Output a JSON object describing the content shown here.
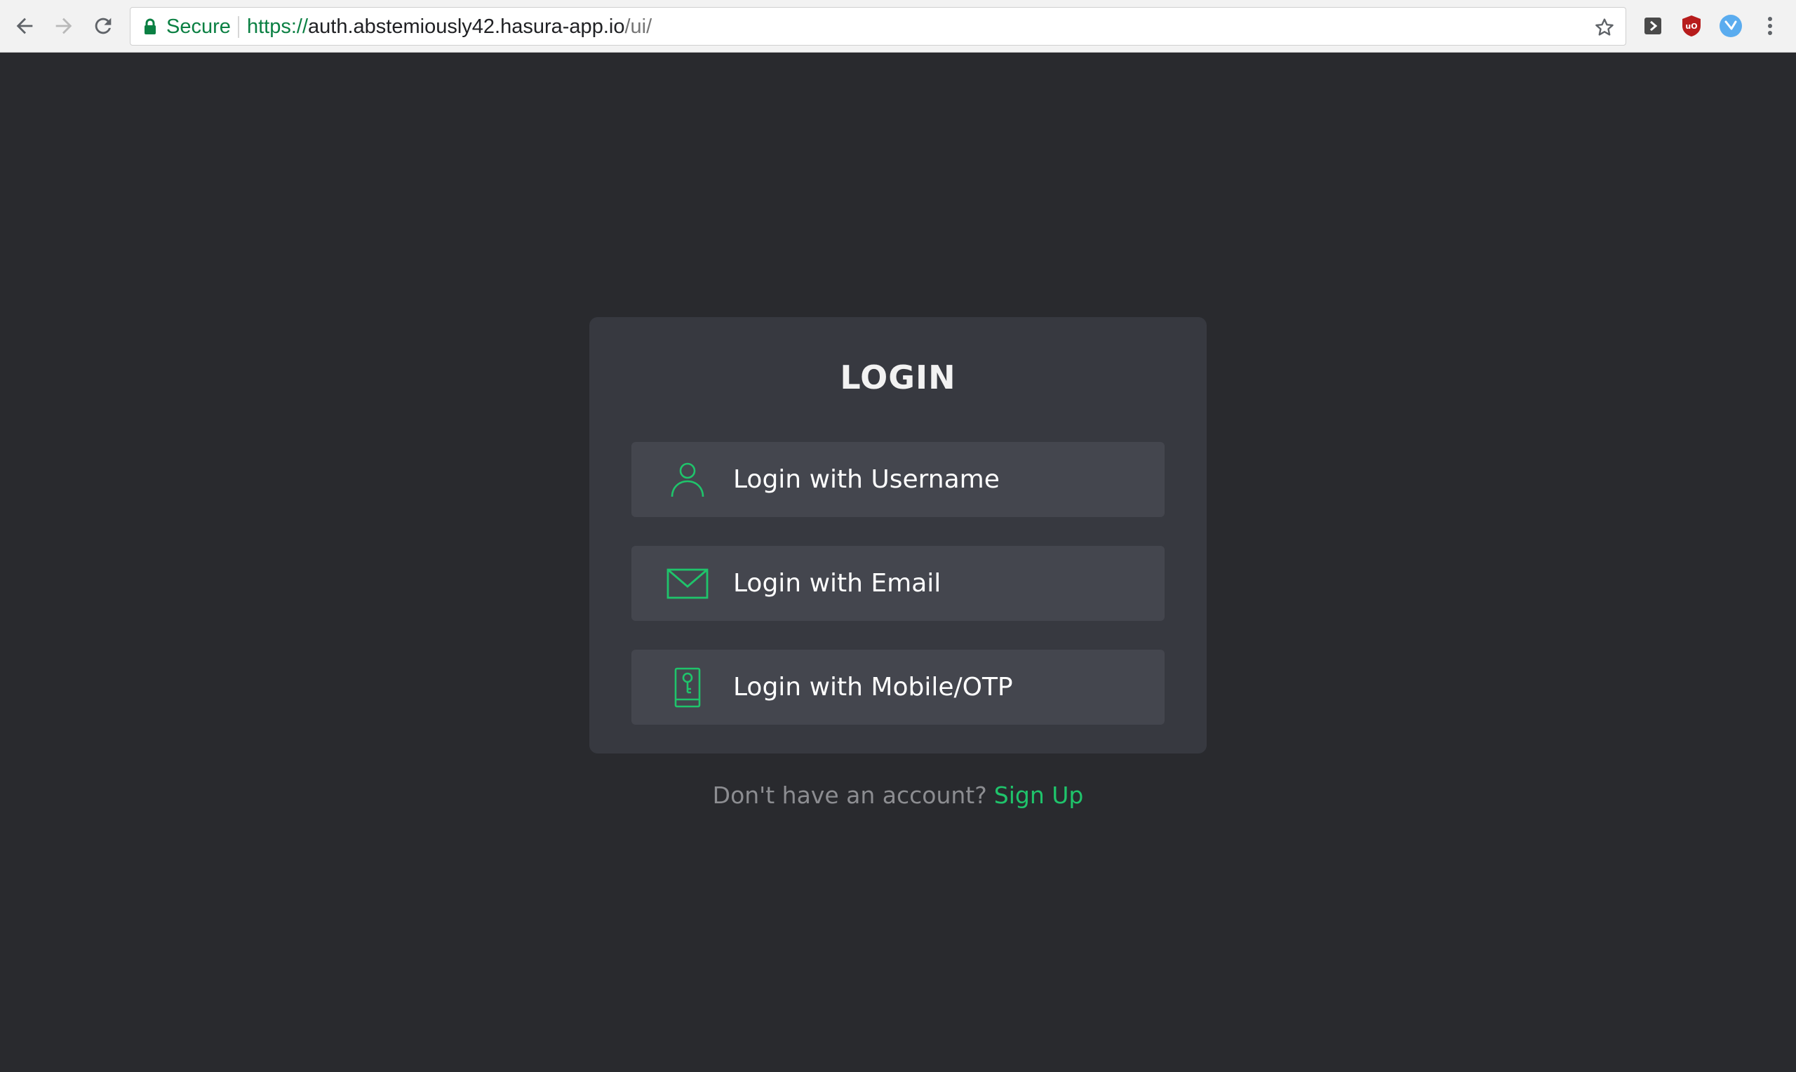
{
  "browser": {
    "omnibox": {
      "secure_label": "Secure",
      "url_scheme": "https://",
      "url_host": "auth.abstemiously42.hasura-app.io",
      "url_path": "/ui/"
    },
    "icons": [
      "back-arrow-icon",
      "forward-arrow-icon",
      "reload-icon",
      "lock-icon",
      "star-icon",
      "extension-icon",
      "ublock-icon",
      "twitter-icon",
      "menu-dots-icon"
    ]
  },
  "login": {
    "title": "LOGIN",
    "options": [
      {
        "label": "Login with Username",
        "icon": "user-icon"
      },
      {
        "label": "Login with Email",
        "icon": "envelope-icon"
      },
      {
        "label": "Login with Mobile/OTP",
        "icon": "mobile-otp-icon"
      }
    ]
  },
  "footer": {
    "prompt": "Don't have an account?",
    "signup_label": "Sign Up"
  },
  "colors": {
    "background": "#292a2e",
    "card": "#373940",
    "option": "#44464e",
    "accent": "#1fc46b",
    "secure_green": "#0b8043"
  }
}
